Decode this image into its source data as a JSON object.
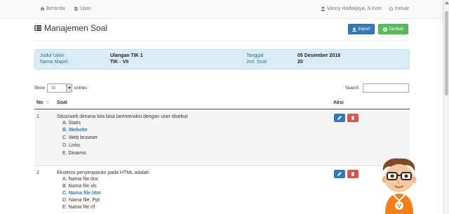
{
  "nav": {
    "beranda": "Beranda",
    "ujian": "Ujian",
    "user": "Vanny Hadwijaya, S.Kom",
    "keluar": "Keluar"
  },
  "page": {
    "title": "Manajemen Soal",
    "import_label": "Import",
    "tambah_label": "Tambah"
  },
  "info": {
    "judul_label": "Judul Ujian",
    "judul_value": "Ulangan TIK 1",
    "mapel_label": "Nama Mapel",
    "mapel_value": "TIK - VII",
    "tanggal_label": "Tanggal",
    "tanggal_value": "05 Desember 2018",
    "jml_label": "Jml. Soal",
    "jml_value": "20"
  },
  "table_controls": {
    "show_label": "Show",
    "entries_value": "10",
    "entries_label": "entries",
    "search_label": "Search:"
  },
  "table": {
    "headers": {
      "no": "No",
      "soal": "Soal",
      "aksi": "Aksi"
    },
    "rows": [
      {
        "no": "1",
        "question": "Situs/web dimana kita bisa berinteraksi dengan user disebut",
        "options": [
          "A. Statis",
          "B. Website",
          "C. Web browser",
          "D. Links",
          "E. Dinamis"
        ],
        "correct_index": 1
      },
      {
        "no": "2",
        "question": "Ekstensi penyimpanan pada HTML adalah",
        "options": [
          "A. Nama file.doc",
          "B. Nama file.xls",
          "C. Nama file.htm",
          "D. Nama file. Ppt",
          "E. Nama file.rtf"
        ],
        "correct_index": 2
      }
    ]
  },
  "colors": {
    "primary": "#337ab7",
    "success": "#5cb85c",
    "danger": "#d9534f",
    "info_bg": "#d9edf7"
  },
  "mascot": {
    "badge_letter": "V"
  }
}
